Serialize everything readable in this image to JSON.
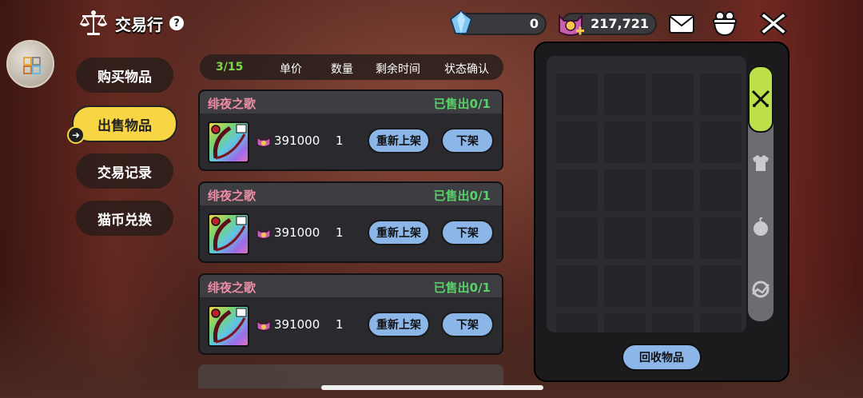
{
  "header": {
    "title": "交易行",
    "help": "?"
  },
  "currency": {
    "gems": "0",
    "coins": "217,721"
  },
  "icons": {
    "scale": "scale-icon",
    "help": "help-icon",
    "avatar": "avatar-icon",
    "gem": "diamond-icon",
    "coin": "cat-coin-icon",
    "mail": "mail-icon",
    "bag": "bag-icon",
    "close": "close-icon"
  },
  "nav": [
    {
      "label": "购买物品",
      "active": false
    },
    {
      "label": "出售物品",
      "active": true
    },
    {
      "label": "交易记录",
      "active": false
    },
    {
      "label": "猫币兑换",
      "active": false
    }
  ],
  "list_header": {
    "count": "3/15",
    "col_price": "单价",
    "col_qty": "数量",
    "col_time": "剩余时间",
    "col_status": "状态确认"
  },
  "listings": [
    {
      "name": "绯夜之歌",
      "status": "已售出0/1",
      "price": "391000",
      "qty": "1",
      "relist": "重新上架",
      "remove": "下架"
    },
    {
      "name": "绯夜之歌",
      "status": "已售出0/1",
      "price": "391000",
      "qty": "1",
      "relist": "重新上架",
      "remove": "下架"
    },
    {
      "name": "绯夜之歌",
      "status": "已售出0/1",
      "price": "391000",
      "qty": "1",
      "relist": "重新上架",
      "remove": "下架"
    }
  ],
  "inventory": {
    "recycle": "回收物品",
    "categories": [
      "weapon-icon",
      "armor-icon",
      "food-icon",
      "material-icon"
    ]
  },
  "colors": {
    "accent": "#f7d545",
    "button": "#8cb6e8",
    "sold": "#59d06a",
    "item_name": "#ef8da6",
    "count": "#7ed84a",
    "active_tab": "#bde04a"
  }
}
